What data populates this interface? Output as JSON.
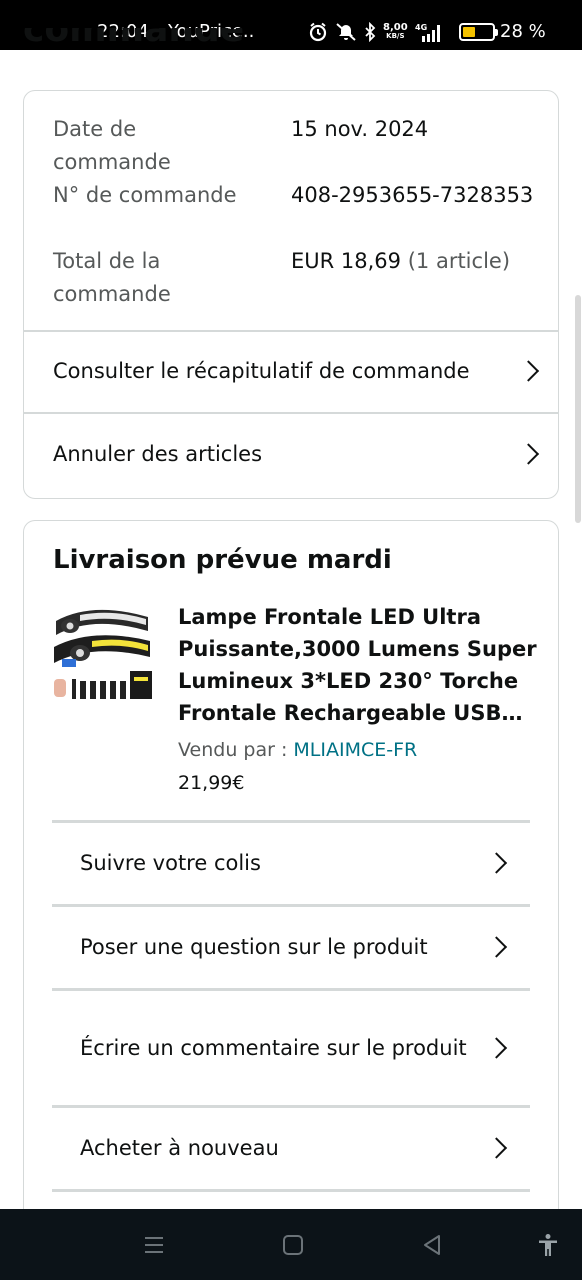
{
  "status_bar": {
    "time": "22:04",
    "app": "YouPrice..",
    "net_speed": "8,00",
    "net_unit": "KB/S",
    "network": "4G",
    "battery_pct": "28 %",
    "battery_level": 0.28
  },
  "page": {
    "heading": "commande"
  },
  "order_summary": {
    "rows": [
      {
        "label": "Date de commande",
        "value": "15 nov. 2024"
      },
      {
        "label": "N° de commande",
        "value": "408-2953655-7328353"
      },
      {
        "label": "Total de la commande",
        "value": "EUR 18,69",
        "value_extra": "(1 article)"
      }
    ],
    "links": [
      {
        "label": "Consulter le récapitulatif de commande"
      },
      {
        "label": "Annuler des articles"
      }
    ]
  },
  "delivery": {
    "title": "Livraison prévue mardi",
    "product": {
      "title": "Lampe Frontale LED Ultra Puissante,3000 Lumens Super Lumineux 3*LED 230° Torche Frontale Rechargeable USB…",
      "seller_label": "Vendu par  :",
      "seller_name": "MLIAIMCE-FR",
      "price": "21,99€"
    },
    "actions": [
      {
        "label": "Suivre votre colis"
      },
      {
        "label": "Poser une question sur le produit"
      },
      {
        "label": "Écrire un commentaire sur le produit"
      },
      {
        "label": "Acheter à nouveau"
      }
    ]
  },
  "colors": {
    "link": "#007185",
    "text": "#0f1111",
    "muted": "#565959",
    "border": "#d5d9d9"
  }
}
